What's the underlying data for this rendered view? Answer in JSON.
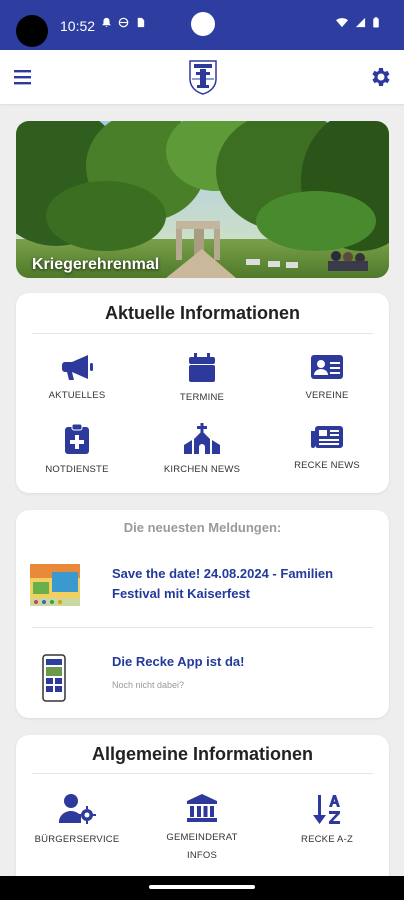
{
  "status_bar": {
    "time": "10:52"
  },
  "app_bar": {
    "menu_icon": "hamburger-menu-icon",
    "settings_icon": "gear-icon",
    "logo": "coat-of-arms-logo"
  },
  "hero": {
    "caption": "Kriegerehrenmal"
  },
  "aktuelle": {
    "title": "Aktuelle Informationen",
    "items": [
      {
        "label": "AKTUELLES",
        "icon": "megaphone-icon"
      },
      {
        "label": "TERMINE",
        "icon": "calendar-icon"
      },
      {
        "label": "VEREINE",
        "icon": "id-card-icon"
      },
      {
        "label": "NOTDIENSTE",
        "icon": "medical-clipboard-icon"
      },
      {
        "label": "KIRCHEN NEWS",
        "icon": "church-icon"
      },
      {
        "label": "RECKE NEWS",
        "icon": "newspaper-icon"
      }
    ]
  },
  "news": {
    "header": "Die neuesten Meldungen:",
    "items": [
      {
        "title_line1": "Save the date! 24.08.2024 - Familien",
        "title_line2": "Festival mit Kaiserfest"
      },
      {
        "title_line1": "Die Recke App ist da!",
        "subtitle": "Noch nicht dabei?"
      }
    ]
  },
  "allgemeine": {
    "title": "Allgemeine Informationen",
    "items": [
      {
        "label": "BÜRGERSERVICE",
        "icon": "user-gear-icon"
      },
      {
        "label_line1": "GEMEINDERAT",
        "label_line2": "INFOS",
        "icon": "town-hall-icon"
      },
      {
        "label": "RECKE A-Z",
        "icon": "sort-alpha-icon"
      }
    ]
  },
  "colors": {
    "brand": "#2d3da0",
    "icon": "#2d3a9c",
    "link": "#243a9a"
  }
}
